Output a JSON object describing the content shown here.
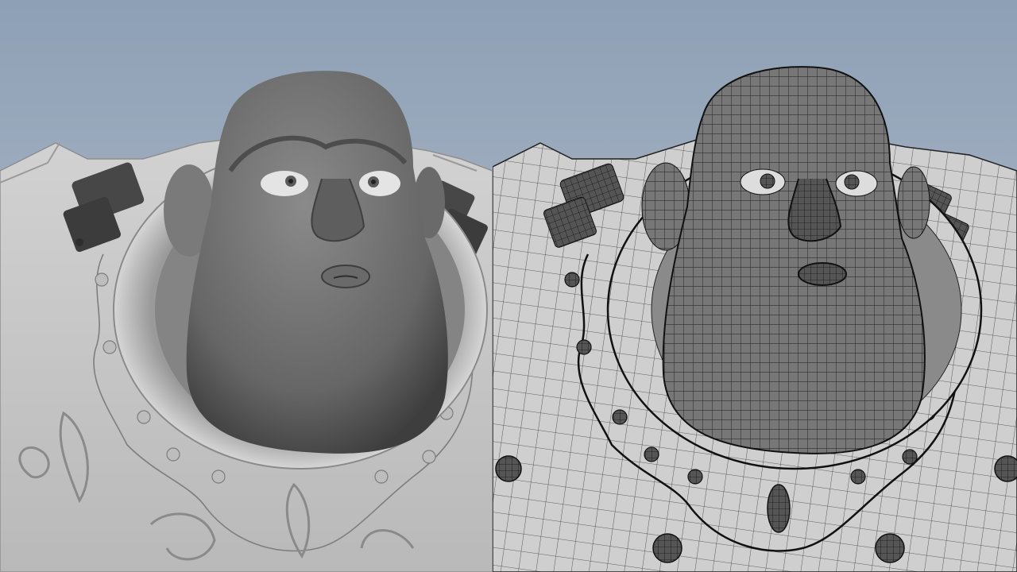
{
  "scene": {
    "background_top": "#8fa0b6",
    "background_bottom": "#b9c2cd",
    "panels": [
      {
        "mode": "smooth-shaded",
        "subject": "character-bust"
      },
      {
        "mode": "wireframe-on-shaded",
        "subject": "character-bust"
      }
    ],
    "colors": {
      "body": "#c8c8c8",
      "head": "#6e6e6e",
      "buckle": "#3e3e3e",
      "wire": "#1a1a1a"
    }
  }
}
